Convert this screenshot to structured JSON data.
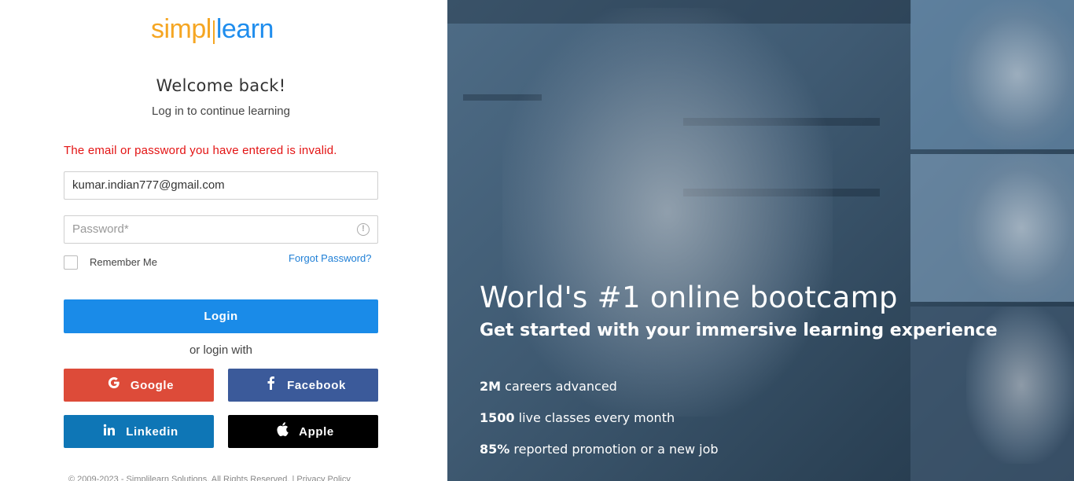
{
  "stray_mark": ";",
  "logo": {
    "part1": "simpl",
    "part2": "learn"
  },
  "welcome": "Welcome back!",
  "subtitle": "Log in to continue learning",
  "error": "The email or password you have entered is invalid.",
  "email_value": "kumar.indian777@gmail.com",
  "password_placeholder": "Password*",
  "info_icon": "!",
  "remember_label": "Remember Me",
  "forgot_label": "Forgot Password?",
  "login_label": "Login",
  "or_label": "or login with",
  "social": {
    "google": "Google",
    "facebook": "Facebook",
    "linkedin": "Linkedin",
    "apple": "Apple"
  },
  "footer": "© 2009-2023 - Simplilearn Solutions. All Rights Reserved. | Privacy Policy",
  "hero": {
    "headline": "World's #1 online bootcamp",
    "tagline": "Get started with your immersive learning experience",
    "stats": [
      {
        "bold": "2M",
        "text": " careers advanced"
      },
      {
        "bold": "1500",
        "text": " live classes every month"
      },
      {
        "bold": "85%",
        "text": " reported promotion or a new job"
      }
    ]
  },
  "colors": {
    "brand_orange": "#f5a623",
    "brand_blue": "#1f8ded",
    "error": "#e31313",
    "login": "#1a8be8",
    "google": "#dd4b39",
    "facebook": "#3b5a9a",
    "linkedin": "#0e76b6",
    "apple": "#000000"
  }
}
